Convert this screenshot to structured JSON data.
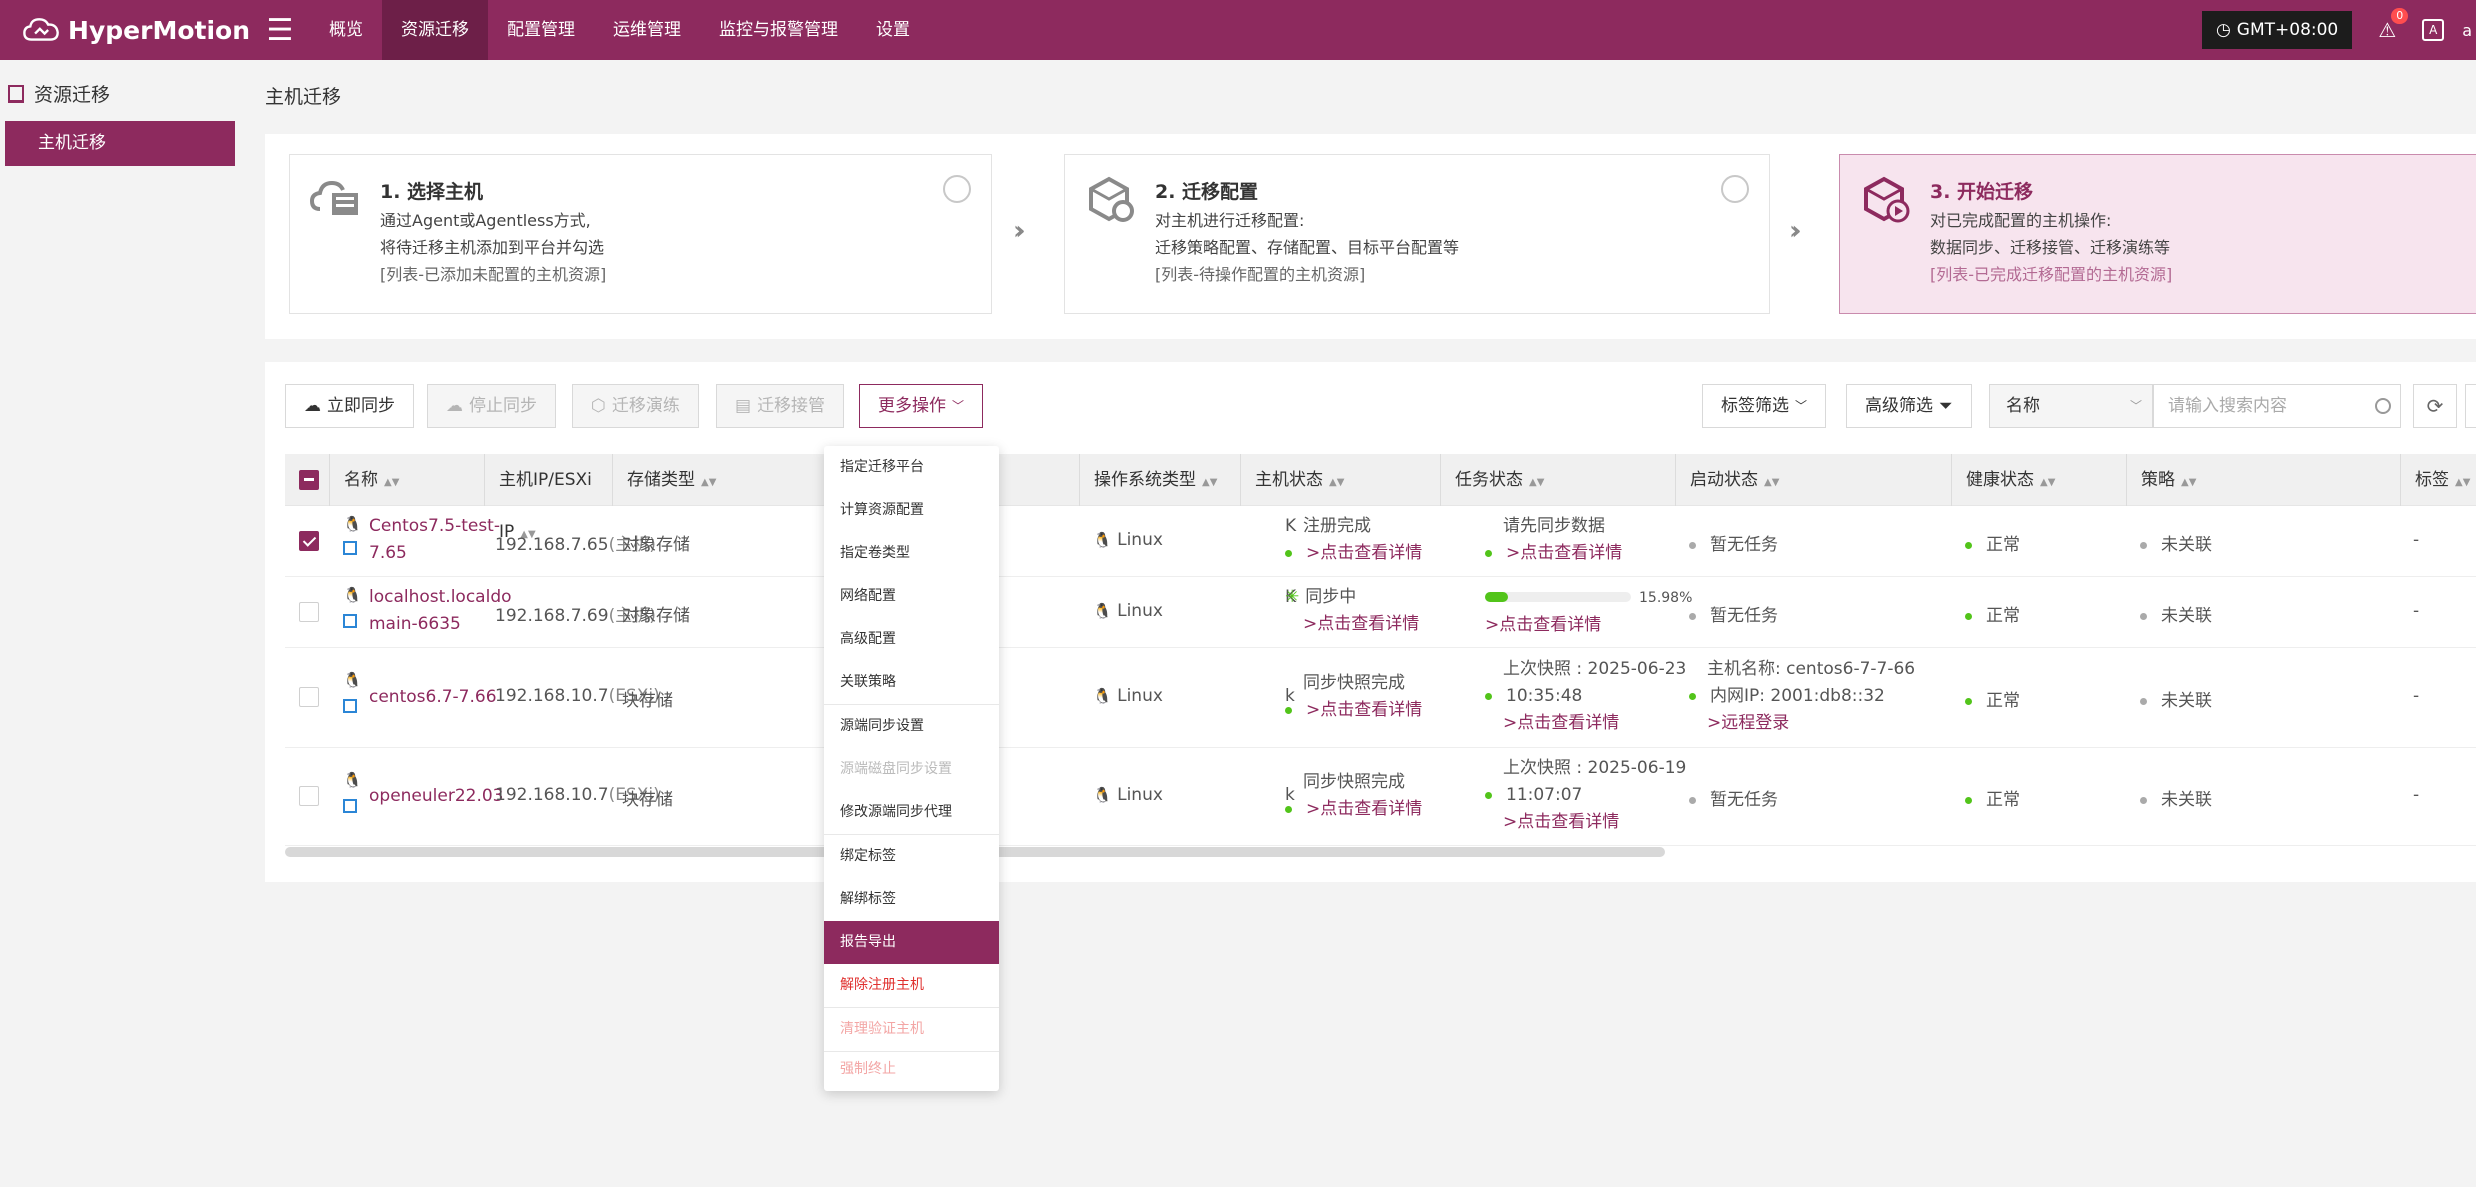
{
  "app": {
    "name": "HyperMotion"
  },
  "nav": {
    "menu_icon": "hamburger-icon",
    "items": [
      "概览",
      "资源迁移",
      "配置管理",
      "运维管理",
      "监控与报警管理",
      "设置"
    ],
    "active": "资源迁移"
  },
  "topbar": {
    "timezone": "GMT+08:00",
    "alert_count": "0",
    "lang_label": "A",
    "user_initial": "a"
  },
  "sidebar": {
    "section": "资源迁移",
    "active_item": "主机迁移"
  },
  "page_title": "主机迁移",
  "steps": [
    {
      "title": "1. 选择主机",
      "line1": "通过Agent或Agentless方式,",
      "line2": "将待迁移主机添加到平台并勾选",
      "line3": "[列表-已添加未配置的主机资源]"
    },
    {
      "title": "2. 迁移配置",
      "line1": "对主机进行迁移配置:",
      "line2": "迁移策略配置、存储配置、目标平台配置等",
      "line3": "[列表-待操作配置的主机资源]"
    },
    {
      "title": "3. 开始迁移",
      "line1": "对已完成配置的主机操作:",
      "line2": "数据同步、迁移接管、迁移演练等",
      "line3": "[列表-已完成迁移配置的主机资源]"
    }
  ],
  "toolbar": {
    "sync_now": "立即同步",
    "stop_sync": "停止同步",
    "drill": "迁移演练",
    "takeover": "迁移接管",
    "more_ops": "更多操作",
    "tag_filter": "标签筛选",
    "adv_filter": "高级筛选",
    "search_field": "名称",
    "search_placeholder": "请输入搜索内容"
  },
  "columns": [
    "名称",
    "主机IP/ESXi IP",
    "存储类型",
    "操作系统类型",
    "主机状态",
    "任务状态",
    "启动状态",
    "健康状态",
    "策略",
    "标签"
  ],
  "rows": [
    {
      "checked": true,
      "name1": "Centos7.5-test-",
      "name2": "7.65",
      "ip": "192.168.7.65",
      "ip_type": "(主机)",
      "storage": "对象存储",
      "hidden_tail": "K",
      "os": "Linux",
      "host_status": "注册完成",
      "host_link": ">点击查看详情",
      "task_line1": "请先同步数据",
      "task_line2": "",
      "task_link": ">点击查看详情",
      "boot": "暂无任务",
      "health": "正常",
      "policy": "未关联",
      "tag": "-"
    },
    {
      "checked": false,
      "name1": "localhost.localdo",
      "name2": "main-6635",
      "ip": "192.168.7.69",
      "ip_type": "(主机)",
      "storage": "对象存储",
      "hidden_tail": "K",
      "os": "Linux",
      "host_status": "同步中",
      "host_link": ">点击查看详情",
      "task_progress": 15.98,
      "task_progress_label": "15.98%",
      "task_link": ">点击查看详情",
      "boot": "暂无任务",
      "health": "正常",
      "policy": "未关联",
      "tag": "-"
    },
    {
      "checked": false,
      "name1": "centos6.7-7.66",
      "name2": "",
      "ip": "192.168.10.7",
      "ip_type": "(ESXi)",
      "storage": "块存储",
      "hidden_tail": "k",
      "os": "Linux",
      "host_status": "同步快照完成",
      "host_link": ">点击查看详情",
      "task_line1": "上次快照 : 2025-06-23",
      "task_line2": "10:35:48",
      "task_link": ">点击查看详情",
      "boot_line1": "主机名称: centos6-7-7-66",
      "boot_line2": "内网IP: 2001:db8::32",
      "boot_link": ">远程登录",
      "health": "正常",
      "policy": "未关联",
      "tag": "-"
    },
    {
      "checked": false,
      "name1": "openeuler22.03",
      "name2": "",
      "ip": "192.168.10.7",
      "ip_type": "(ESXi)",
      "storage": "块存储",
      "hidden_tail": "k",
      "os": "Linux",
      "host_status": "同步快照完成",
      "host_link": ">点击查看详情",
      "task_line1": "上次快照 : 2025-06-19",
      "task_line2": "11:07:07",
      "task_link": ">点击查看详情",
      "boot": "暂无任务",
      "health": "正常",
      "policy": "未关联",
      "tag": "-"
    }
  ],
  "dropdown": [
    "指定迁移平台",
    "计算资源配置",
    "指定卷类型",
    "网络配置",
    "高级配置",
    "关联策略",
    "源端同步设置",
    "源端磁盘同步设置",
    "修改源端同步代理",
    "绑定标签",
    "解绑标签",
    "报告导出",
    "解除注册主机",
    "清理验证主机",
    "强制终止"
  ],
  "colors": {
    "brand": "#8d2a5e",
    "success": "#52c41a",
    "danger": "#e0312f"
  }
}
